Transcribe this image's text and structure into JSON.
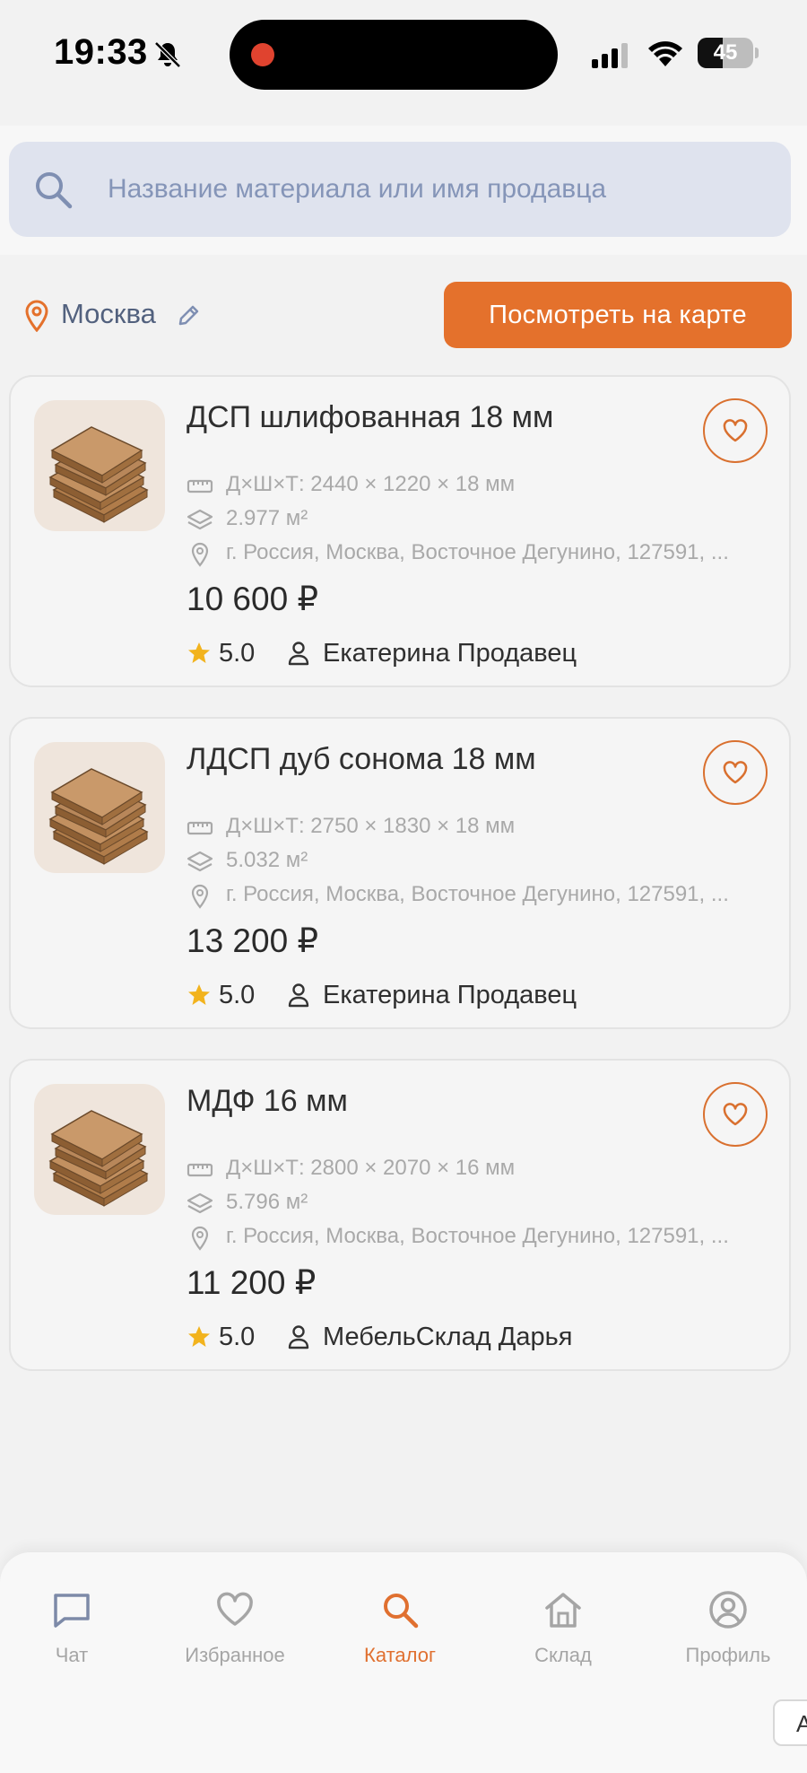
{
  "status_bar": {
    "time": "19:33",
    "battery_level": "45",
    "battery_fraction": 0.45
  },
  "search": {
    "placeholder": "Название материала или имя продавца",
    "value": ""
  },
  "location": {
    "city": "Москва",
    "map_button_label": "Посмотреть на карте"
  },
  "colors": {
    "accent": "#e4712c",
    "search_bg": "#dfe3ee",
    "muted_text": "#a9a9a9",
    "star": "#f2b31d"
  },
  "products": [
    {
      "title": "ДСП шлифованная 18 мм",
      "dimensions": "Д×Ш×Т: 2440 × 1220 × 18 мм",
      "area": "2.977 м²",
      "address": "г. Россия, Москва, Восточное Дегунино, 127591, ...",
      "price": "10 600 ₽",
      "rating": "5.0",
      "seller": "Екатерина Продавец"
    },
    {
      "title": "ЛДСП дуб сонома 18 мм",
      "dimensions": "Д×Ш×Т: 2750 × 1830 × 18 мм",
      "area": "5.032 м²",
      "address": "г. Россия, Москва, Восточное Дегунино, 127591, ...",
      "price": "13 200 ₽",
      "rating": "5.0",
      "seller": "Екатерина Продавец"
    },
    {
      "title": "МДФ 16 мм",
      "dimensions": "Д×Ш×Т: 2800 × 2070 × 16 мм",
      "area": "5.796 м²",
      "address": "г. Россия, Москва, Восточное Дегунино, 127591, ...",
      "price": "11 200 ₽",
      "rating": "5.0",
      "seller": "МебельСклад Дарья"
    }
  ],
  "nav": [
    {
      "label": "Чат",
      "icon": "chat-icon",
      "active": false
    },
    {
      "label": "Избранное",
      "icon": "heart-icon",
      "active": false
    },
    {
      "label": "Каталог",
      "icon": "search-icon",
      "active": true
    },
    {
      "label": "Склад",
      "icon": "warehouse-icon",
      "active": false
    },
    {
      "label": "Профиль",
      "icon": "profile-icon",
      "active": false
    }
  ],
  "corner_tab_letter": "A"
}
